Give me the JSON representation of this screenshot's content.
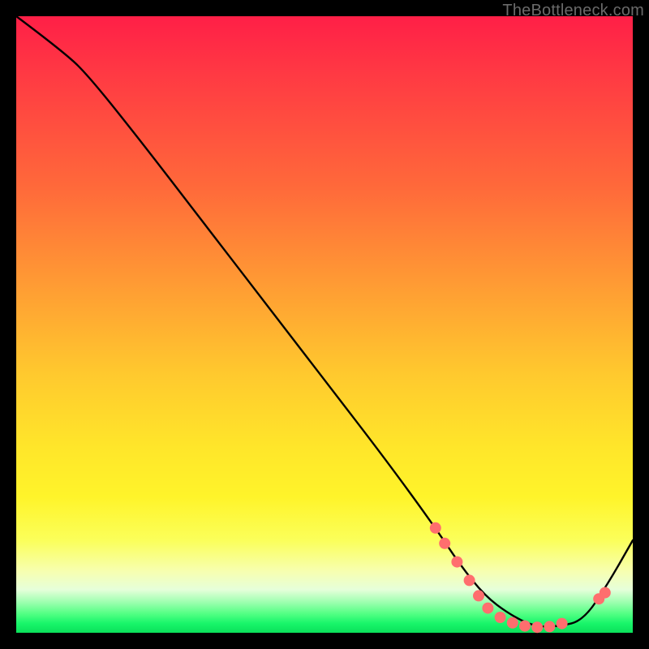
{
  "watermark": "TheBottleneck.com",
  "chart_data": {
    "type": "line",
    "title": "",
    "xlabel": "",
    "ylabel": "",
    "xlim": [
      0,
      100
    ],
    "ylim": [
      0,
      100
    ],
    "series": [
      {
        "name": "curve",
        "x": [
          0,
          8,
          12,
          20,
          30,
          40,
          50,
          60,
          68,
          72,
          76,
          80,
          84,
          88,
          92,
          96,
          100
        ],
        "y": [
          100,
          94,
          90,
          80,
          67,
          54,
          41,
          28,
          17,
          11,
          6,
          3,
          1,
          1,
          2,
          8,
          15
        ]
      }
    ],
    "markers": {
      "name": "highlight-dots",
      "color": "#ff6e6e",
      "points": [
        {
          "x": 68.0,
          "y": 17.0
        },
        {
          "x": 69.5,
          "y": 14.5
        },
        {
          "x": 71.5,
          "y": 11.5
        },
        {
          "x": 73.5,
          "y": 8.5
        },
        {
          "x": 75.0,
          "y": 6.0
        },
        {
          "x": 76.5,
          "y": 4.0
        },
        {
          "x": 78.5,
          "y": 2.5
        },
        {
          "x": 80.5,
          "y": 1.6
        },
        {
          "x": 82.5,
          "y": 1.1
        },
        {
          "x": 84.5,
          "y": 0.9
        },
        {
          "x": 86.5,
          "y": 1.0
        },
        {
          "x": 88.5,
          "y": 1.5
        },
        {
          "x": 94.5,
          "y": 5.5
        },
        {
          "x": 95.5,
          "y": 6.5
        }
      ]
    },
    "gradient_bands": [
      {
        "color": "#ff1f47",
        "from": 100,
        "to": 80
      },
      {
        "color": "#ff8a36",
        "from": 80,
        "to": 55
      },
      {
        "color": "#ffd42a",
        "from": 55,
        "to": 30
      },
      {
        "color": "#fff97a",
        "from": 30,
        "to": 10
      },
      {
        "color": "#32e873",
        "from": 10,
        "to": 0
      }
    ]
  }
}
